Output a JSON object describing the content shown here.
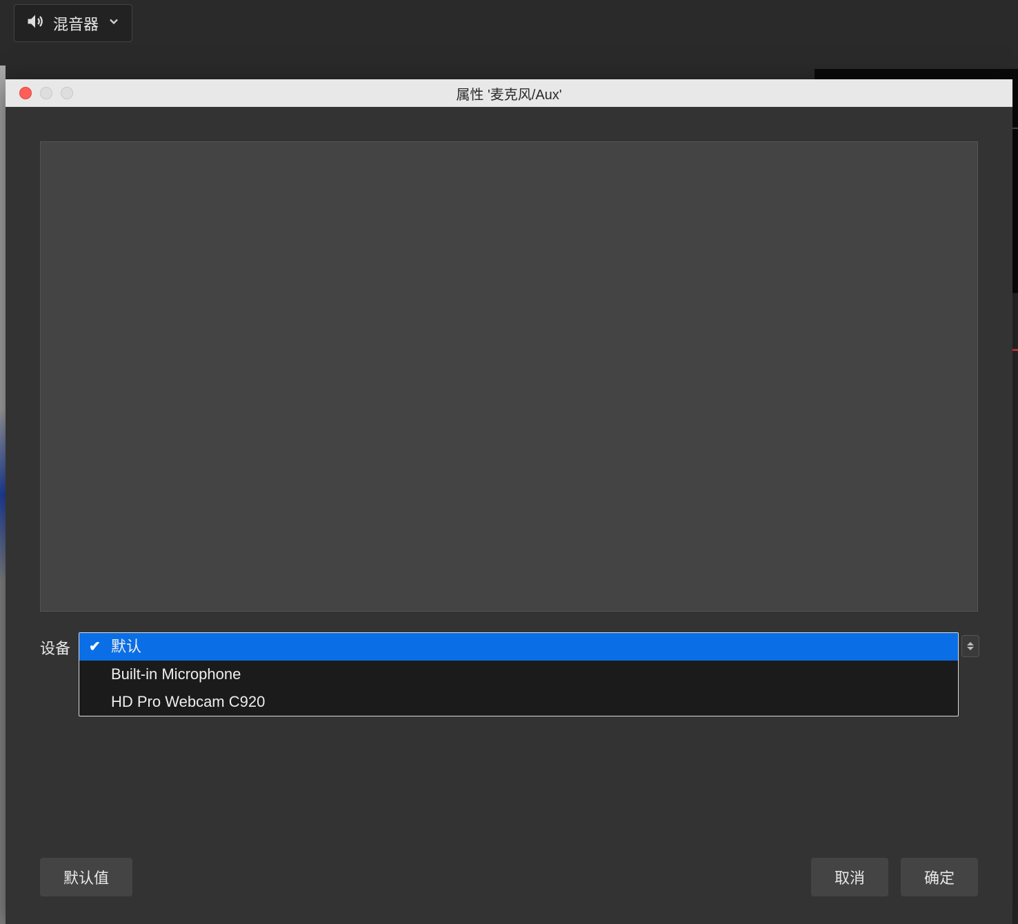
{
  "toolbar": {
    "mixer_label": "混音器"
  },
  "dialog": {
    "title": "属性 '麦克风/Aux'",
    "device_label": "设备",
    "dropdown": {
      "selected": "默认",
      "options": [
        {
          "label": "默认",
          "selected": true
        },
        {
          "label": "Built-in Microphone",
          "selected": false
        },
        {
          "label": "HD Pro Webcam C920",
          "selected": false
        }
      ]
    },
    "buttons": {
      "defaults": "默认值",
      "cancel": "取消",
      "ok": "确定"
    }
  }
}
